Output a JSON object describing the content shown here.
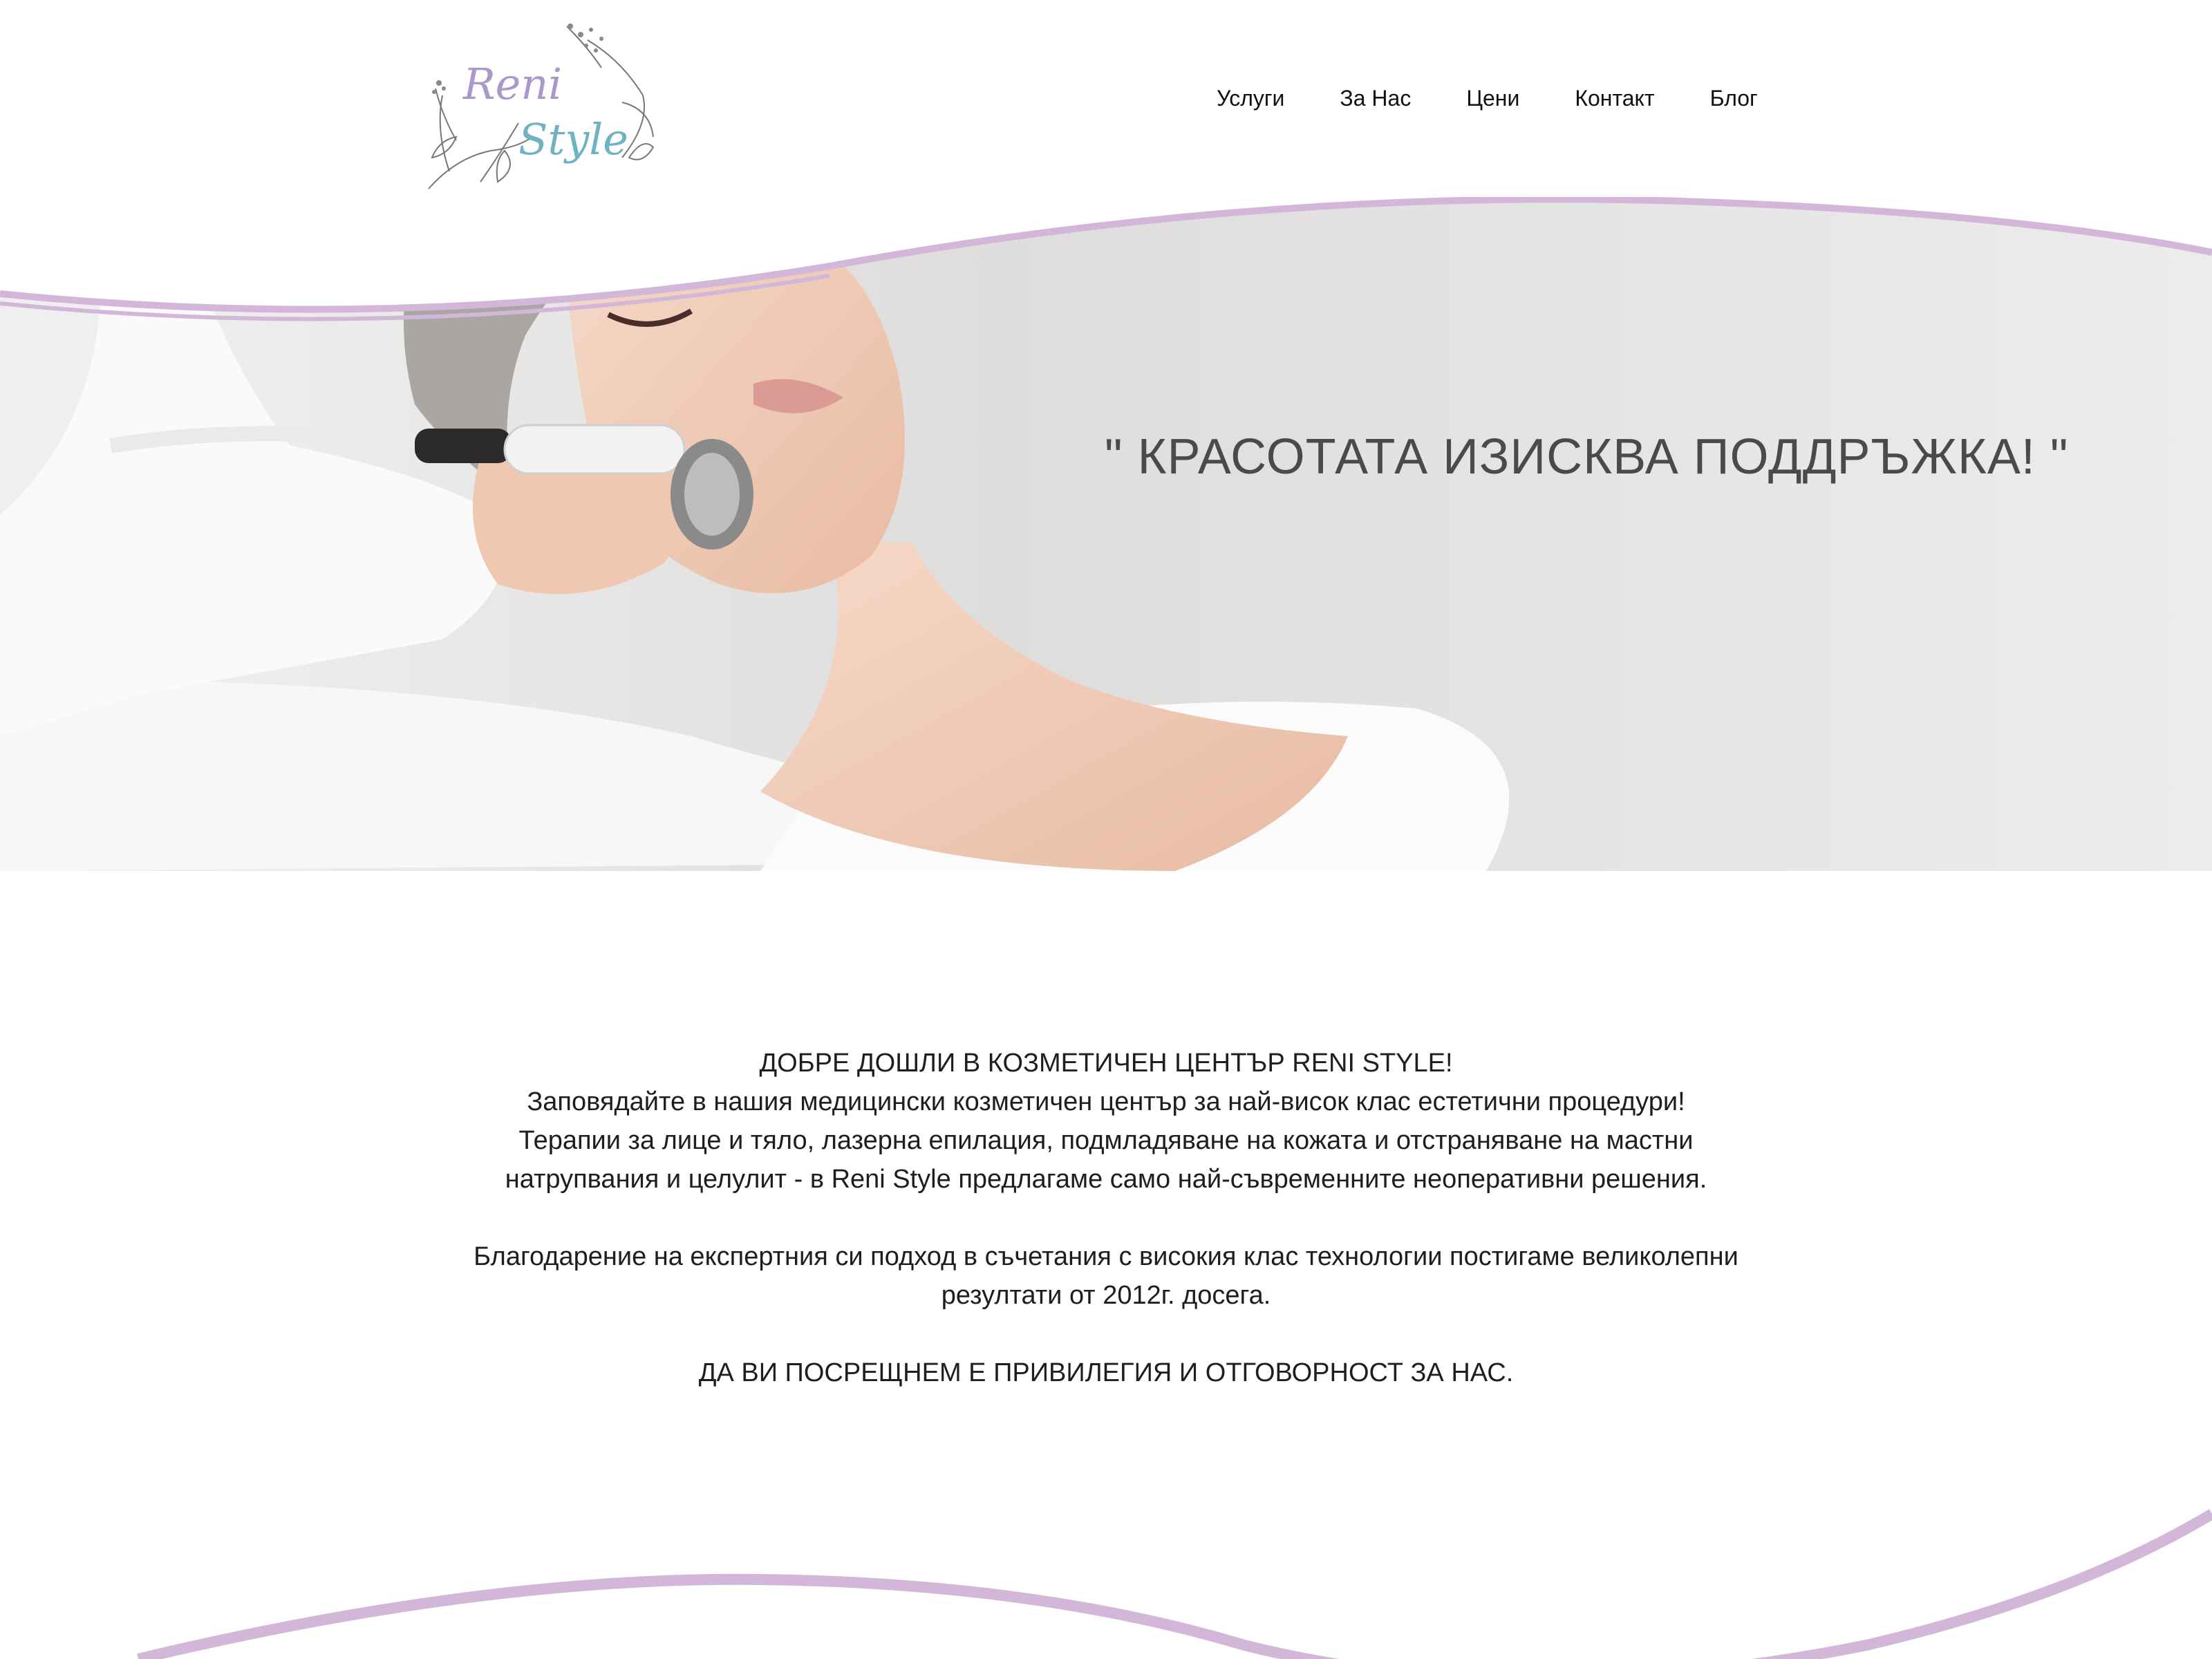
{
  "header": {
    "logo": {
      "text_line1": "Reni",
      "text_line2": "Style"
    },
    "nav": [
      {
        "label": "Услуги"
      },
      {
        "label": "За Нас"
      },
      {
        "label": "Цени"
      },
      {
        "label": "Контакт"
      },
      {
        "label": "Блог"
      }
    ]
  },
  "hero": {
    "title": "\" КРАСОТАТА ИЗИСКВА ПОДДРЪЖКА! \""
  },
  "intro": {
    "line1": "ДОБРЕ ДОШЛИ В КОЗМЕТИЧЕН ЦЕНТЪР RENI STYLE!",
    "line2": "Заповядайте в нашия медицински козметичен център за най-висок клас естетични процедури!",
    "line3": "Терапии за лице и тяло, лазерна епилация, подмладяване на кожата и отстраняване на мастни",
    "line4": "натрупвания и целулит - в Reni Style предлагаме само най-съвременните неоперативни решения.",
    "line5": "Благодарение на експертния си подход в съчетания с високия клас технологии постигаме великолепни",
    "line6": "резултати от 2012г. досега.",
    "line7": "ДА ВИ ПОСРЕЩНЕМ Е ПРИВИЛЕГИЯ И ОТГОВОРНОСТ ЗА НАС."
  },
  "colors": {
    "accent": "#d3b7d9",
    "logo_purple": "#a998c9",
    "logo_teal": "#6fb2c2",
    "text": "#1e1e1e"
  }
}
